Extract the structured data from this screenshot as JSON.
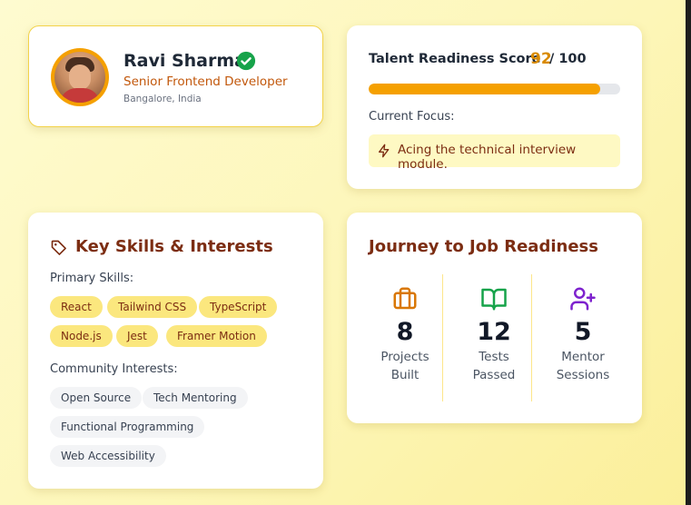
{
  "profile": {
    "name": "Ravi Sharma",
    "role": "Senior Frontend Developer",
    "location": "Bangalore, India",
    "verified_icon": "check-circle-icon"
  },
  "score": {
    "title": "Talent Readiness Score",
    "value": "92",
    "max": "/ 100",
    "progress_percent": 92,
    "focus_label": "Current Focus:",
    "focus_text": "Acing the technical interview module.",
    "focus_icon": "lightning-icon"
  },
  "skills": {
    "title": "Key Skills & Interests",
    "title_icon": "tag-icon",
    "primary_label": "Primary Skills:",
    "primary": [
      "React",
      "Tailwind CSS",
      "TypeScript",
      "Node.js",
      "Jest",
      "Framer Motion"
    ],
    "interests_label": "Community Interests:",
    "interests": [
      "Open Source",
      "Tech Mentoring",
      "Functional Programming",
      "Web Accessibility"
    ]
  },
  "journey": {
    "title": "Journey to Job Readiness",
    "stats": [
      {
        "icon": "briefcase-icon",
        "value": "8",
        "label_line1": "Projects",
        "label_line2": "Built",
        "color": "#d97706"
      },
      {
        "icon": "book-open-icon",
        "value": "12",
        "label_line1": "Tests",
        "label_line2": "Passed",
        "color": "#16a34a"
      },
      {
        "icon": "user-plus-icon",
        "value": "5",
        "label_line1": "Mentor",
        "label_line2": "Sessions",
        "color": "#7e22ce"
      }
    ]
  },
  "colors": {
    "accent": "#f5a000",
    "heading": "#7c2d12",
    "role": "#c2580c",
    "chip_primary": "#fbe77e",
    "chip_interest": "#f3f4f6"
  }
}
